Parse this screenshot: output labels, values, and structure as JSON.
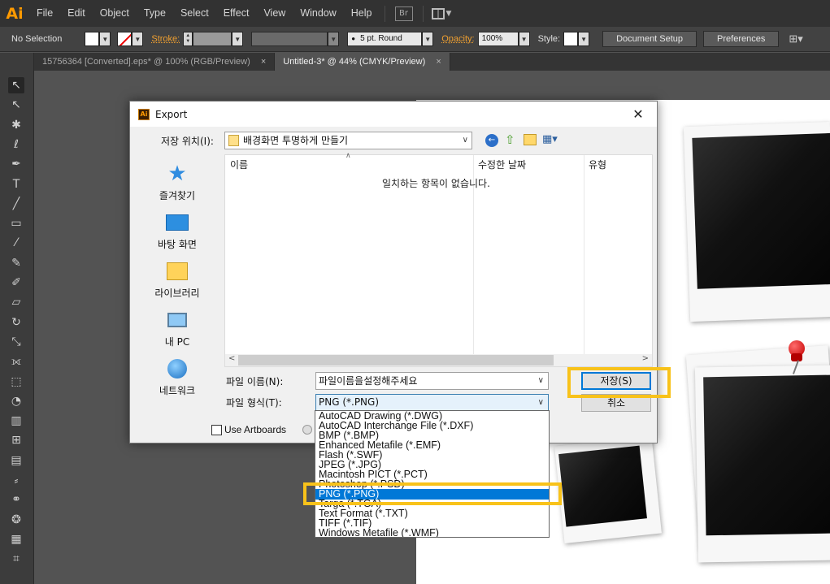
{
  "app": {
    "logo": "Ai",
    "menu": [
      "File",
      "Edit",
      "Object",
      "Type",
      "Select",
      "Effect",
      "View",
      "Window",
      "Help"
    ],
    "bridge_icon": "Br"
  },
  "control_bar": {
    "selection": "No Selection",
    "stroke_label": "Stroke:",
    "brush": "5 pt. Round",
    "opacity_label": "Opacity:",
    "opacity_value": "100%",
    "style_label": "Style:",
    "document_setup": "Document Setup",
    "preferences": "Preferences"
  },
  "tabs": [
    {
      "label": "15756364 [Converted].eps* @ 100% (RGB/Preview)",
      "active": false
    },
    {
      "label": "Untitled-3* @ 44% (CMYK/Preview)",
      "active": true
    }
  ],
  "tab_close_glyph": "×",
  "tools": [
    {
      "name": "selection-tool-icon",
      "glyph": "↖"
    },
    {
      "name": "direct-selection-tool-icon",
      "glyph": "↖"
    },
    {
      "name": "magic-wand-tool-icon",
      "glyph": "✱"
    },
    {
      "name": "lasso-tool-icon",
      "glyph": "ℓ"
    },
    {
      "name": "pen-tool-icon",
      "glyph": "✒"
    },
    {
      "name": "type-tool-icon",
      "glyph": "T"
    },
    {
      "name": "line-tool-icon",
      "glyph": "╱"
    },
    {
      "name": "rectangle-tool-icon",
      "glyph": "▭"
    },
    {
      "name": "paintbrush-tool-icon",
      "glyph": "⁄"
    },
    {
      "name": "pencil-tool-icon",
      "glyph": "✎"
    },
    {
      "name": "blob-brush-tool-icon",
      "glyph": "✐"
    },
    {
      "name": "eraser-tool-icon",
      "glyph": "▱"
    },
    {
      "name": "rotate-tool-icon",
      "glyph": "↻"
    },
    {
      "name": "scale-tool-icon",
      "glyph": "⤡"
    },
    {
      "name": "width-tool-icon",
      "glyph": "⟗"
    },
    {
      "name": "free-transform-tool-icon",
      "glyph": "⬚"
    },
    {
      "name": "shape-builder-tool-icon",
      "glyph": "◔"
    },
    {
      "name": "perspective-grid-tool-icon",
      "glyph": "▥"
    },
    {
      "name": "mesh-tool-icon",
      "glyph": "⊞"
    },
    {
      "name": "gradient-tool-icon",
      "glyph": "▤"
    },
    {
      "name": "eyedropper-tool-icon",
      "glyph": "⸗"
    },
    {
      "name": "blend-tool-icon",
      "glyph": "⚭"
    },
    {
      "name": "symbol-sprayer-tool-icon",
      "glyph": "❂"
    },
    {
      "name": "column-graph-tool-icon",
      "glyph": "▦"
    },
    {
      "name": "artboard-tool-icon",
      "glyph": "⌗"
    }
  ],
  "dialog": {
    "title": "Export",
    "close_glyph": "✕",
    "save_in_label": "저장 위치(I):",
    "save_in_value": "배경화면 투명하게 만들기",
    "places": [
      "즐겨찾기",
      "바탕 화면",
      "라이브러리",
      "내 PC",
      "네트워크"
    ],
    "columns": [
      "이름",
      "수정한 날짜",
      "유형"
    ],
    "empty_message": "일치하는 항목이 없습니다.",
    "filename_label": "파일 이름(N):",
    "filename_value": "파일이름을설정해주세요",
    "filetype_label": "파일 형식(T):",
    "filetype_value": "PNG (*.PNG)",
    "save_button": "저장(S)",
    "cancel_button": "취소",
    "use_artboards": "Use Artboards"
  },
  "format_options": [
    "AutoCAD Drawing (*.DWG)",
    "AutoCAD Interchange File (*.DXF)",
    "BMP (*.BMP)",
    "Enhanced Metafile (*.EMF)",
    "Flash (*.SWF)",
    "JPEG (*.JPG)",
    "Macintosh PICT (*.PCT)",
    "Photoshop (*.PSD)",
    "PNG (*.PNG)",
    "Targa (*.TGA)",
    "Text Format (*.TXT)",
    "TIFF (*.TIF)",
    "Windows Metafile (*.WMF)"
  ],
  "selected_format_index": 8,
  "colors": {
    "highlight": "#f8c21a",
    "selection_blue": "#0078d7",
    "ai_orange": "#ff9a00"
  }
}
